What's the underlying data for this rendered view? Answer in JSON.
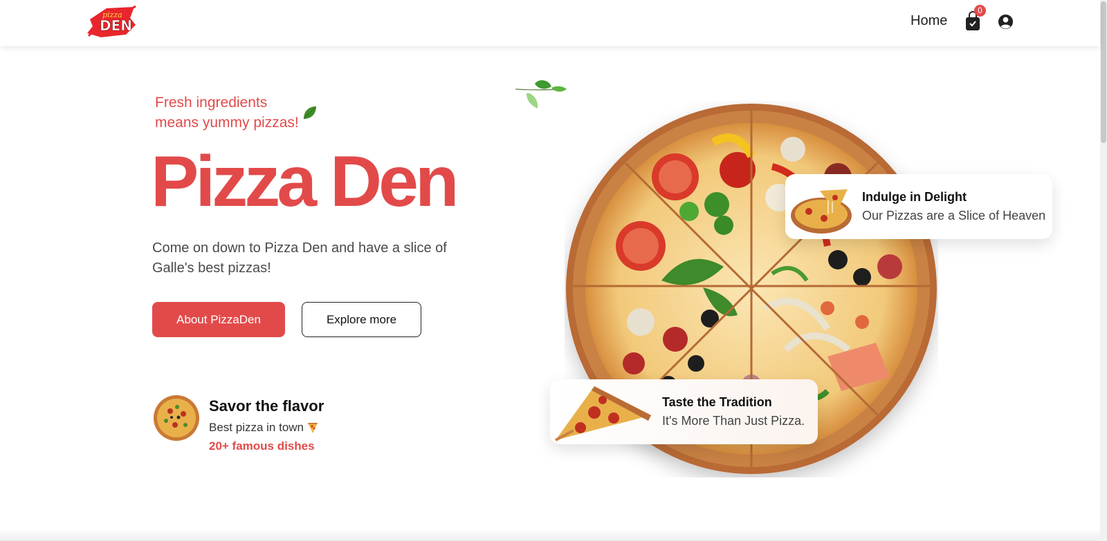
{
  "brand": {
    "logo_top": "pizza",
    "logo_main": "DEN",
    "accent": "#e24a4a"
  },
  "nav": {
    "home_label": "Home",
    "cart_count": "0",
    "cart_icon": "shopping-bag-icon",
    "account_icon": "user-circle-icon"
  },
  "hero": {
    "tagline_line1": "Fresh ingredients",
    "tagline_line2": "means yummy pizzas!",
    "title": "Pizza Den",
    "description": "Come on down to Pizza Den and have a slice of Galle's best pizzas!",
    "primary_button": "About PizzaDen",
    "secondary_button": "Explore more"
  },
  "savor": {
    "title": "Savor the flavor",
    "subtitle": "Best pizza in town",
    "count": "20+ famous dishes"
  },
  "cards": [
    {
      "title": "Indulge in Delight",
      "subtitle": "Our Pizzas are a Slice of Heaven"
    },
    {
      "title": "Taste the Tradition",
      "subtitle": "It's More Than Just Pizza."
    }
  ]
}
